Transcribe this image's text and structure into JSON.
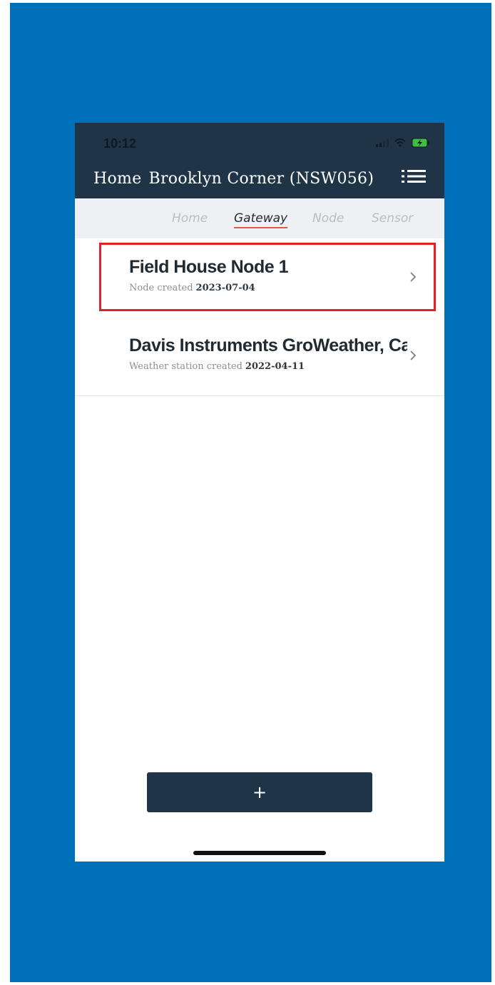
{
  "status_bar": {
    "time": "10:12"
  },
  "header": {
    "breadcrumb_home": "Home",
    "title": "Brooklyn Corner (NSW056)",
    "menu_icon": "list-menu-icon"
  },
  "tabs": [
    {
      "label": "Home",
      "active": false
    },
    {
      "label": "Gateway",
      "active": true
    },
    {
      "label": "Node",
      "active": false
    },
    {
      "label": "Sensor",
      "active": false
    }
  ],
  "items": [
    {
      "title": "Field House Node 1",
      "subtitle_prefix": "Node created",
      "date": "2023-07-04",
      "highlighted": true
    },
    {
      "title": "Davis Instruments GroWeather, Cabl...",
      "subtitle_prefix": "Weather station created",
      "date": "2022-04-11",
      "highlighted": false
    }
  ],
  "add_button": {
    "label": "+"
  },
  "colors": {
    "frame": "#0070ba",
    "header": "#1f3447",
    "tab_bar": "#eef0f3",
    "active_underline": "#e05a3c",
    "highlight": "#e3202a"
  }
}
